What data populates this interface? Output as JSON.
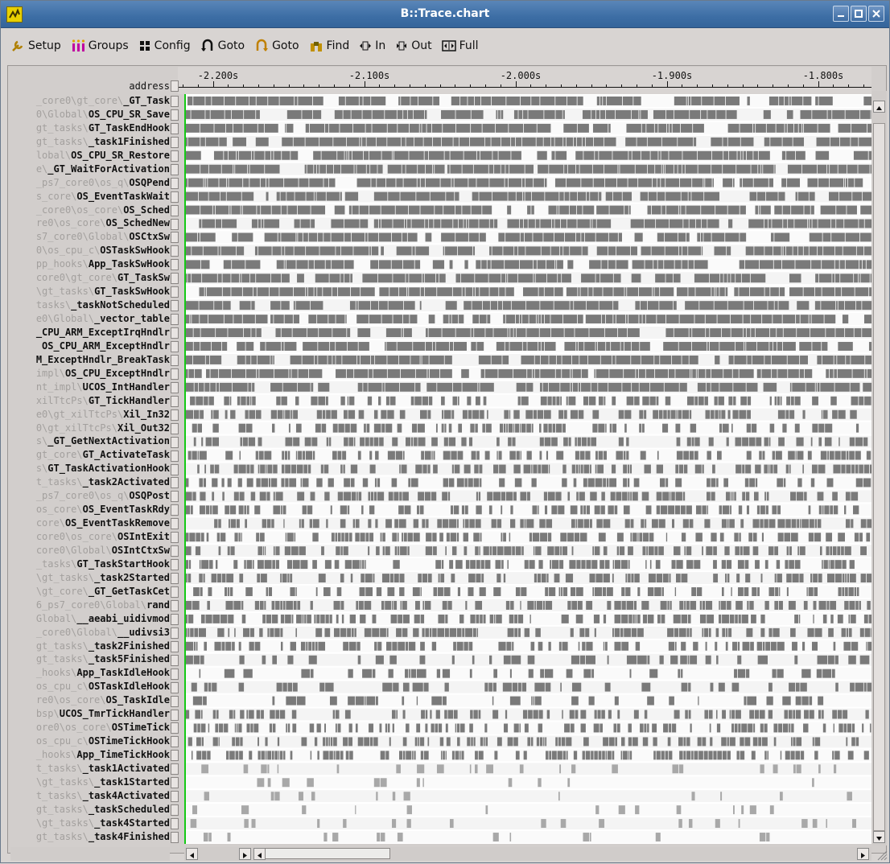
{
  "window": {
    "title": "B::Trace.chart"
  },
  "toolbar": [
    {
      "label": "Setup",
      "icon": "wrench-icon"
    },
    {
      "label": "Groups",
      "icon": "groups-icon"
    },
    {
      "label": "Config",
      "icon": "config-icon"
    },
    {
      "label": "Goto",
      "icon": "goto-back-icon"
    },
    {
      "label": "Goto",
      "icon": "goto-forward-icon"
    },
    {
      "label": "Find",
      "icon": "binoculars-icon"
    },
    {
      "label": "In",
      "icon": "zoom-in-icon"
    },
    {
      "label": "Out",
      "icon": "zoom-out-icon"
    },
    {
      "label": "Full",
      "icon": "zoom-full-icon"
    }
  ],
  "ruler": {
    "ticks": [
      "-2.200s",
      "-2.100s",
      "-2.000s",
      "-1.900s",
      "-1.800s"
    ]
  },
  "column_header": "address",
  "rows": [
    {
      "prefix": "_core0\\gt_core\\",
      "name": "_GT_Task"
    },
    {
      "prefix": "0\\Global\\",
      "name": "OS_CPU_SR_Save"
    },
    {
      "prefix": "gt_tasks\\",
      "name": "GT_TaskEndHook"
    },
    {
      "prefix": "gt_tasks\\",
      "name": "_task1Finished"
    },
    {
      "prefix": "lobal\\",
      "name": "OS_CPU_SR_Restore"
    },
    {
      "prefix": "e\\",
      "name": "_GT_WaitForActivation"
    },
    {
      "prefix": "_ps7_core0\\os_q\\",
      "name": "OSQPend"
    },
    {
      "prefix": "s_core\\",
      "name": "OS_EventTaskWait"
    },
    {
      "prefix": "_core0\\os_core\\",
      "name": "OS_Sched"
    },
    {
      "prefix": "re0\\os_core\\",
      "name": "OS_SchedNew"
    },
    {
      "prefix": "s7_core0\\Global\\",
      "name": "OSCtxSw"
    },
    {
      "prefix": "0\\os_cpu_c\\",
      "name": "OSTaskSwHook"
    },
    {
      "prefix": "pp_hooks\\",
      "name": "App_TaskSwHook"
    },
    {
      "prefix": "core0\\gt_core\\",
      "name": "GT_TaskSw"
    },
    {
      "prefix": "\\gt_tasks\\",
      "name": "GT_TaskSwHook"
    },
    {
      "prefix": "tasks\\",
      "name": "_taskNotScheduled"
    },
    {
      "prefix": "e0\\Global\\",
      "name": "_vector_table"
    },
    {
      "prefix": "",
      "name": "_CPU_ARM_ExceptIrqHndlr"
    },
    {
      "prefix": "",
      "name": "OS_CPU_ARM_ExceptHndlr"
    },
    {
      "prefix": "",
      "name": "M_ExceptHndlr_BreakTask"
    },
    {
      "prefix": "impl\\",
      "name": "OS_CPU_ExceptHndlr"
    },
    {
      "prefix": "nt_impl\\",
      "name": "UCOS_IntHandler"
    },
    {
      "prefix": "xilTtcPs\\",
      "name": "GT_TickHandler"
    },
    {
      "prefix": "e0\\gt_xilTtcPs\\",
      "name": "Xil_In32"
    },
    {
      "prefix": "0\\gt_xilTtcPs\\",
      "name": "Xil_Out32"
    },
    {
      "prefix": "s\\",
      "name": "_GT_GetNextActivation"
    },
    {
      "prefix": "gt_core\\",
      "name": "GT_ActivateTask"
    },
    {
      "prefix": "s\\",
      "name": "GT_TaskActivationHook"
    },
    {
      "prefix": "t_tasks\\",
      "name": "_task2Activated"
    },
    {
      "prefix": "_ps7_core0\\os_q\\",
      "name": "OSQPost"
    },
    {
      "prefix": "os_core\\",
      "name": "OS_EventTaskRdy"
    },
    {
      "prefix": "core\\",
      "name": "OS_EventTaskRemove"
    },
    {
      "prefix": "core0\\os_core\\",
      "name": "OSIntExit"
    },
    {
      "prefix": "core0\\Global\\",
      "name": "OSIntCtxSw"
    },
    {
      "prefix": "_tasks\\",
      "name": "GT_TaskStartHook"
    },
    {
      "prefix": "\\gt_tasks\\",
      "name": "_task2Started"
    },
    {
      "prefix": "\\gt_core\\",
      "name": "_GT_GetTaskCet"
    },
    {
      "prefix": "6_ps7_core0\\Global\\",
      "name": "rand"
    },
    {
      "prefix": "Global\\",
      "name": "__aeabi_uidivmod"
    },
    {
      "prefix": "_core0\\Global\\",
      "name": "__udivsi3"
    },
    {
      "prefix": "gt_tasks\\",
      "name": "_task2Finished"
    },
    {
      "prefix": "gt_tasks\\",
      "name": "_task5Finished"
    },
    {
      "prefix": "_hooks\\",
      "name": "App_TaskIdleHook"
    },
    {
      "prefix": "os_cpu_c\\",
      "name": "OSTaskIdleHook"
    },
    {
      "prefix": "re0\\os_core\\",
      "name": "OS_TaskIdle"
    },
    {
      "prefix": "bsp\\",
      "name": "UCOS_TmrTickHandler"
    },
    {
      "prefix": "ore0\\os_core\\",
      "name": "OSTimeTick"
    },
    {
      "prefix": "os_cpu_c\\",
      "name": "OSTimeTickHook"
    },
    {
      "prefix": "_hooks\\",
      "name": "App_TimeTickHook"
    },
    {
      "prefix": "t_tasks\\",
      "name": "_task1Activated"
    },
    {
      "prefix": "\\gt_tasks\\",
      "name": "_task1Started"
    },
    {
      "prefix": "t_tasks\\",
      "name": "_task4Activated"
    },
    {
      "prefix": "gt_tasks\\",
      "name": "_taskScheduled"
    },
    {
      "prefix": "\\gt_tasks\\",
      "name": "_task4Started"
    },
    {
      "prefix": "gt_tasks\\",
      "name": "_task4Finished"
    }
  ],
  "colors": {
    "bar": "#7a7a7a",
    "bar_light": "#a8a8a8",
    "marker": "#1ec81e",
    "plot_bg": "#ffffff"
  }
}
